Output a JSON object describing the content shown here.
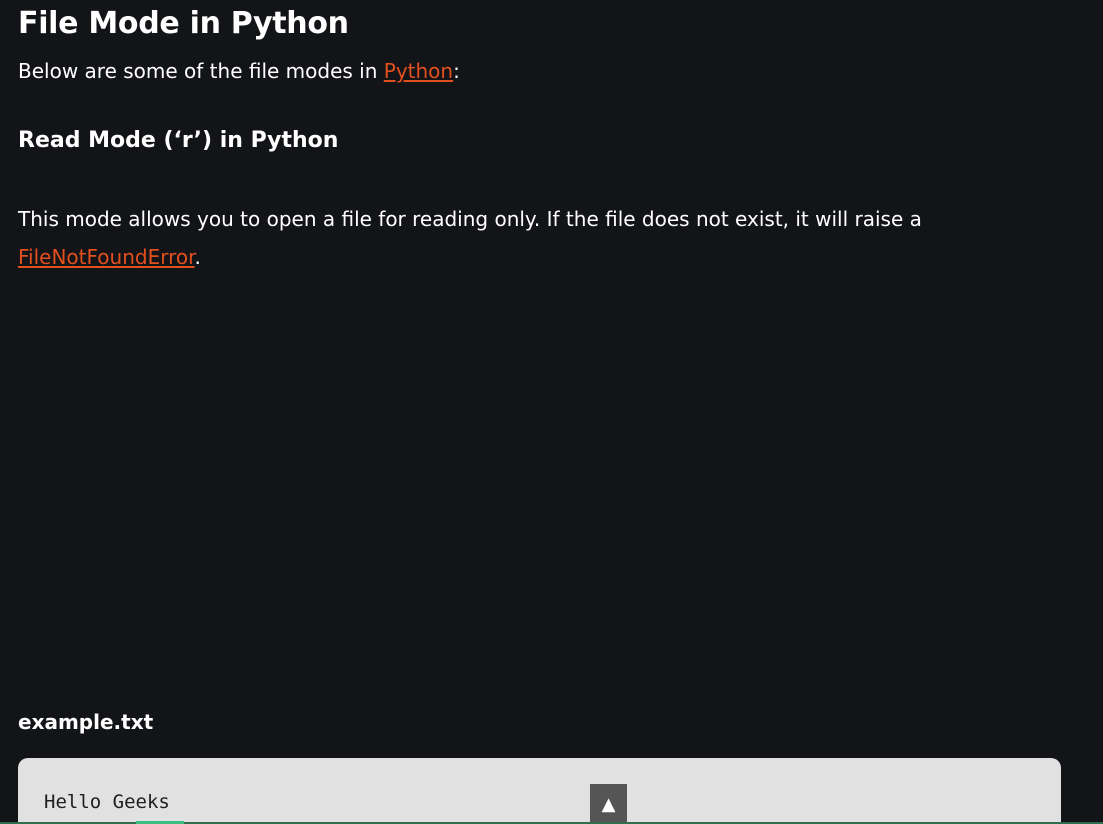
{
  "article": {
    "title": "File Mode in Python",
    "intro_prefix": "Below are some of the file modes in ",
    "intro_link": "Python",
    "intro_suffix": ":",
    "section_title": "Read Mode (‘r’) in Python",
    "desc_text": "This mode allows you to open a file for reading only. If the file does not exist, it will raise a ",
    "desc_link": "FileNotFoundError",
    "desc_suffix": ".",
    "file_label": "example.txt",
    "code_content": "Hello Geeks"
  },
  "controls": {
    "scroll_top_icon": "▲"
  },
  "colors": {
    "background": "#131417",
    "link": "#e2501f",
    "code_background": "#e1e1e1"
  }
}
